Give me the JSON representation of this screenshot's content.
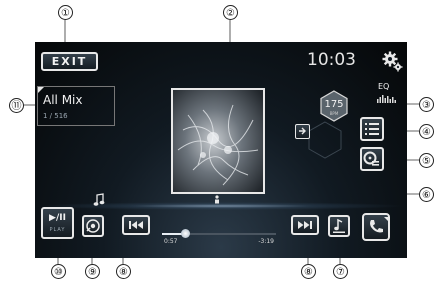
{
  "callouts": {
    "c1": "①",
    "c2": "②",
    "c3": "③",
    "c4": "④",
    "c5": "⑤",
    "c6": "⑥",
    "c7": "⑦",
    "c8a": "⑧",
    "c8b": "⑧",
    "c9": "⑨",
    "c10": "⑩",
    "c11": "⑪"
  },
  "screen": {
    "exit_label": "EXIT",
    "clock": "10:03",
    "eq_label": "EQ",
    "playlist": {
      "title": "All Mix",
      "track_index": "1 / 516"
    },
    "bpm": {
      "value": "175",
      "unit": "BPM"
    },
    "play_pause": {
      "symbol": "▶/II",
      "sub_label": "PLAY"
    },
    "time": {
      "elapsed": "0:57",
      "remaining": "-3:19",
      "progress": 0.2
    },
    "icons": {
      "settings": "gear-icon",
      "list": "list-icon",
      "source": "disc-list-icon",
      "arrow": "arrow-right-icon",
      "music_note": "music-note-icon",
      "phone": "phone-icon"
    }
  }
}
